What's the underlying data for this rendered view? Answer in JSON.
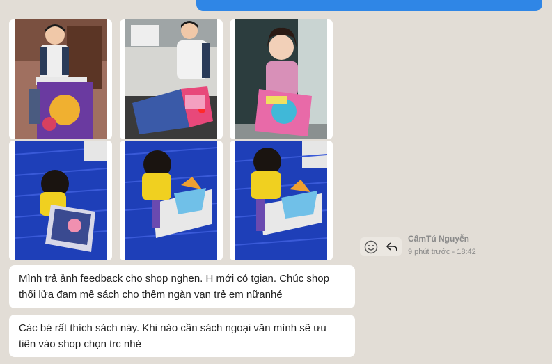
{
  "chat": {
    "sender_name": "CấmTú Nguyễn",
    "timestamp": "9 phút trước - 18:42",
    "messages": [
      "Mình trả ảnh feedback cho shop nghen. H mới có tgian. Chúc shop thổi lửa đam mê sách cho thêm ngàn vạn trẻ em nữanhé",
      "Các bé rất thích sách này. Khi nào cần sách ngoại văn mình sẽ ưu tiên vào shop chọn trc nhé"
    ],
    "photos": [
      {
        "subject": "boy-with-piano-book"
      },
      {
        "subject": "boy-with-sound-book"
      },
      {
        "subject": "girl-holding-book"
      },
      {
        "subject": "girl-reading-in-hammock"
      },
      {
        "subject": "girl-with-popup-book"
      },
      {
        "subject": "girl-with-popup-book-2"
      }
    ],
    "actions": {
      "react_icon": "smiley-icon",
      "reply_icon": "reply-arrow-icon"
    },
    "colors": {
      "background": "#e2ddd6",
      "outgoing_bubble": "#2f86e6",
      "bubble": "#ffffff",
      "meta_text": "#8a8a8a"
    }
  }
}
